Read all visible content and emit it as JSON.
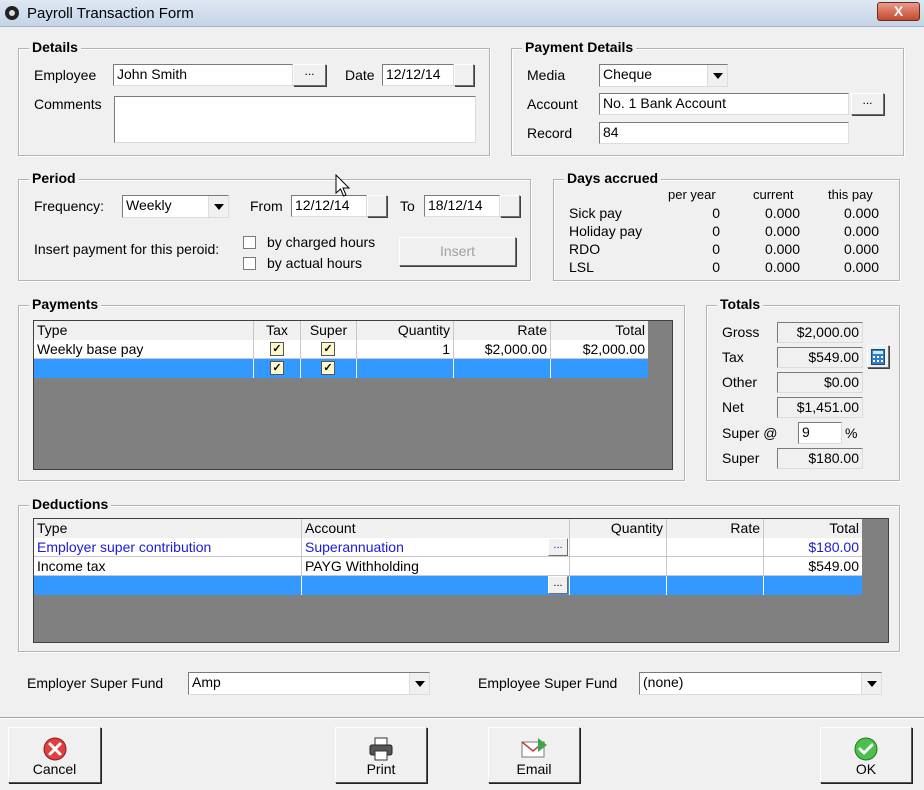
{
  "window": {
    "title": "Payroll Transaction Form",
    "close_glyph": "X"
  },
  "details": {
    "legend": "Details",
    "employee_label": "Employee",
    "employee_value": "John Smith",
    "date_label": "Date",
    "date_value": "12/12/14",
    "comments_label": "Comments",
    "comments_value": "",
    "browse": "..."
  },
  "payment_details": {
    "legend": "Payment Details",
    "media_label": "Media",
    "media_value": "Cheque",
    "account_label": "Account",
    "account_value": "No. 1 Bank Account",
    "record_label": "Record",
    "record_value": "84",
    "browse": "..."
  },
  "period": {
    "legend": "Period",
    "frequency_label": "Frequency:",
    "frequency_value": "Weekly",
    "from_label": "From",
    "from_value": "12/12/14",
    "to_label": "To",
    "to_value": "18/12/14",
    "insert_label": "Insert payment for this peroid:",
    "by_charged": "by charged hours",
    "by_actual": "by actual hours",
    "insert_button": "Insert"
  },
  "days_accrued": {
    "legend": "Days accrued",
    "headers": [
      "per year",
      "current",
      "this pay"
    ],
    "rows": [
      {
        "label": "Sick pay",
        "per_year": "0",
        "current": "0.000",
        "this_pay": "0.000"
      },
      {
        "label": "Holiday pay",
        "per_year": "0",
        "current": "0.000",
        "this_pay": "0.000"
      },
      {
        "label": "RDO",
        "per_year": "0",
        "current": "0.000",
        "this_pay": "0.000"
      },
      {
        "label": "LSL",
        "per_year": "0",
        "current": "0.000",
        "this_pay": "0.000"
      }
    ]
  },
  "payments": {
    "legend": "Payments",
    "headers": {
      "type": "Type",
      "tax": "Tax",
      "super": "Super",
      "quantity": "Quantity",
      "rate": "Rate",
      "total": "Total"
    },
    "rows": [
      {
        "type": "Weekly base pay",
        "tax": true,
        "super": true,
        "quantity": "1",
        "rate": "$2,000.00",
        "total": "$2,000.00"
      }
    ],
    "check_glyph": "✓"
  },
  "totals": {
    "legend": "Totals",
    "gross_label": "Gross",
    "gross_value": "$2,000.00",
    "tax_label": "Tax",
    "tax_value": "$549.00",
    "other_label": "Other",
    "other_value": "$0.00",
    "net_label": "Net",
    "net_value": "$1,451.00",
    "super_at_label": "Super @",
    "super_pct": "9",
    "pct_sign": "%",
    "super_label": "Super",
    "super_value": "$180.00",
    "calculator_icon": "calculator-icon"
  },
  "deductions": {
    "legend": "Deductions",
    "headers": {
      "type": "Type",
      "account": "Account",
      "quantity": "Quantity",
      "rate": "Rate",
      "total": "Total"
    },
    "rows": [
      {
        "type": "Employer super contribution",
        "account": "Superannuation",
        "quantity": "",
        "rate": "",
        "total": "$180.00",
        "color": "#1a1ad8"
      },
      {
        "type": "Income tax",
        "account": "PAYG Withholding",
        "quantity": "",
        "rate": "",
        "total": "$549.00",
        "color": "#000000"
      }
    ],
    "browse": "..."
  },
  "funds": {
    "employer_label": "Employer Super Fund",
    "employer_value": "Amp",
    "employee_label": "Employee Super Fund",
    "employee_value": "(none)"
  },
  "buttons": {
    "cancel": "Cancel",
    "print": "Print",
    "email": "Email",
    "ok": "OK"
  },
  "colors": {
    "selection": "#3399ff",
    "grid_bg": "#808080",
    "link_blue": "#1a1ad8"
  }
}
